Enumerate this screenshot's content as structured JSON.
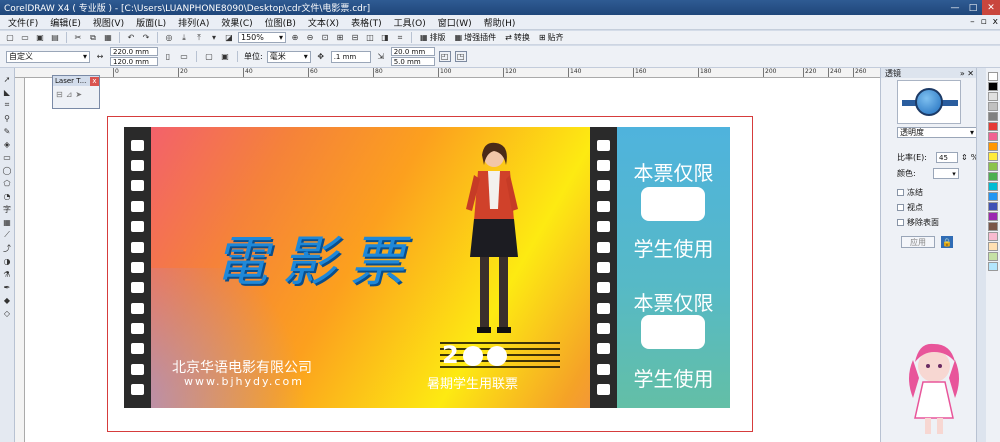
{
  "window": {
    "title": "CorelDRAW X4 ( 专业版 ) - [C:\\Users\\LUANPHONE8090\\Desktop\\cdr文件\\电影票.cdr]",
    "min": "—",
    "max": "□",
    "close": "✕"
  },
  "menu": [
    "文件(F)",
    "编辑(E)",
    "视图(V)",
    "版面(L)",
    "排列(A)",
    "效果(C)",
    "位图(B)",
    "文本(X)",
    "表格(T)",
    "工具(O)",
    "窗口(W)",
    "帮助(H)"
  ],
  "toolbar1": {
    "zoom": "150%",
    "plugins": [
      "排版",
      "增强插件",
      "转换",
      "贴齐"
    ]
  },
  "toolbar2": {
    "page_preset": "自定义",
    "page_width": "220.0 mm",
    "page_height": "120.0 mm",
    "unit_label": "单位:",
    "unit_value": "毫米",
    "nudge": ".1 mm",
    "dup_x": "20.0 mm",
    "dup_y": "5.0 mm"
  },
  "ruler": {
    "ticks": [
      "0",
      "20",
      "40",
      "60",
      "80",
      "100",
      "120",
      "140",
      "160",
      "180",
      "200",
      "220",
      "240",
      "260"
    ]
  },
  "laser_docker": {
    "title": "Laser T...",
    "close": "x"
  },
  "ticket": {
    "title": "電影票",
    "company": "北京华语电影有限公司",
    "website": "www.bjhydy.com",
    "year": "2",
    "event": "暑期学生用联票",
    "stub_top": "本票仅限",
    "stub_use_top": "学生使用",
    "stub_bottom": "本票仅限",
    "stub_use_bottom": "学生使用"
  },
  "docker": {
    "title": "透镜",
    "lens_type": "透明度",
    "rate_label": "比率(E):",
    "rate_value": "45",
    "rate_unit": "%",
    "color_label": "颜色:",
    "freeze_label": "冻结",
    "viewpoint_label": "视点",
    "remove_face_label": "移除表面",
    "apply_label": "应用"
  },
  "palette_colors": [
    "#ffffff",
    "#000000",
    "#e0e0e0",
    "#c0c0c0",
    "#808080",
    "#e53935",
    "#f06292",
    "#ff9800",
    "#ffeb3b",
    "#8bc34a",
    "#4caf50",
    "#00bcd4",
    "#2196f3",
    "#3f51b5",
    "#9c27b0",
    "#795548",
    "#f8bbd0",
    "#ffe0b2",
    "#c5e1a5",
    "#b3e5fc"
  ]
}
